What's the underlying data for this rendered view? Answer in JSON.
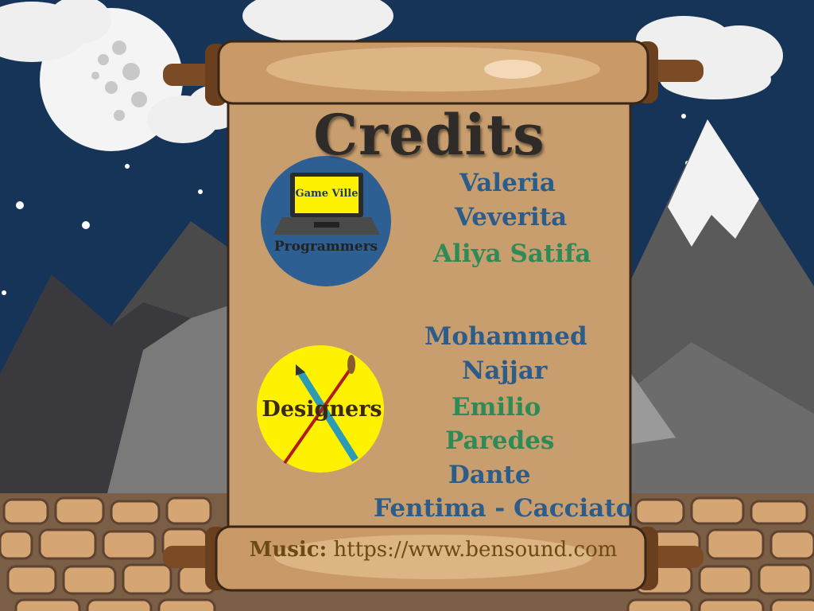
{
  "title": "Credits",
  "programmers": {
    "screen_text": "Game Ville",
    "label": "Programmers",
    "names": [
      "Valeria",
      "Veverita",
      "Aliya Satifa"
    ]
  },
  "designers": {
    "label": "Designers",
    "names": [
      "Mohammed",
      "Najjar",
      "Emilio",
      "Paredes",
      "Dante",
      "Fentima - Cacciato"
    ]
  },
  "music": {
    "label": "Music:",
    "url": "https://www.bensound.com"
  },
  "colors": {
    "sky": "#163358",
    "parchment": "#c89e6e",
    "name_blue": "#2b5c8a",
    "name_green": "#2e8b57",
    "programmer_badge": "#2d5f92",
    "designer_badge": "#fff200"
  }
}
